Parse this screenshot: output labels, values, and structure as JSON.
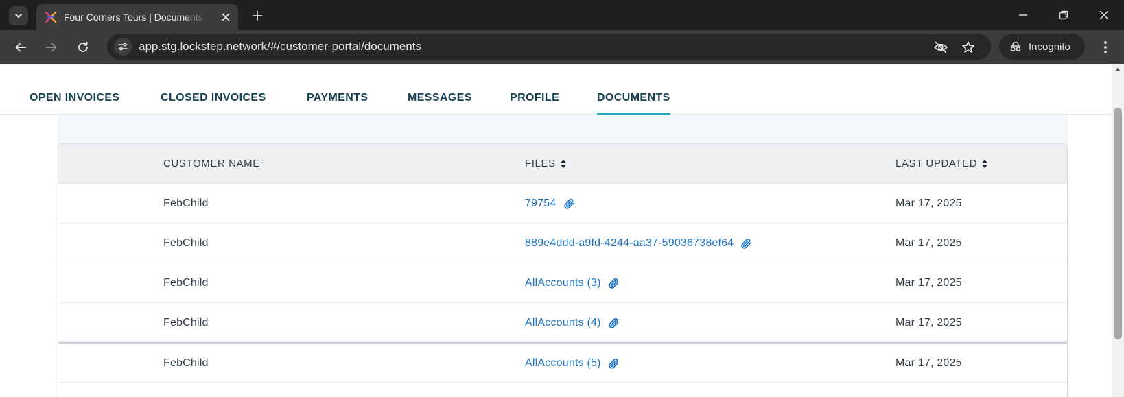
{
  "browser": {
    "tab_title": "Four Corners Tours | Documents",
    "url": "app.stg.lockstep.network/#/customer-portal/documents",
    "incognito_label": "Incognito",
    "colors": {
      "tabbar": "#1f1f1f",
      "toolbar": "#3c3c3c",
      "omnibox": "#282828"
    }
  },
  "nav": {
    "tabs": [
      {
        "label": "OPEN INVOICES"
      },
      {
        "label": "CLOSED INVOICES"
      },
      {
        "label": "PAYMENTS"
      },
      {
        "label": "MESSAGES"
      },
      {
        "label": "PROFILE"
      },
      {
        "label": "DOCUMENTS",
        "active": true
      }
    ],
    "accent_color": "#23a8bd"
  },
  "table": {
    "headers": {
      "customer_name": "CUSTOMER NAME",
      "files": "FILES",
      "last_updated": "LAST UPDATED"
    },
    "rows": [
      {
        "customer": "FebChild",
        "file": "79754",
        "updated": "Mar 17, 2025"
      },
      {
        "customer": "FebChild",
        "file": "889e4ddd-a9fd-4244-aa37-59036738ef64",
        "updated": "Mar 17, 2025"
      },
      {
        "customer": "FebChild",
        "file": "AllAccounts (3)",
        "updated": "Mar 17, 2025"
      },
      {
        "customer": "FebChild",
        "file": "AllAccounts (4)",
        "updated": "Mar 17, 2025"
      },
      {
        "customer": "FebChild",
        "file": "AllAccounts (5)",
        "updated": "Mar 17, 2025"
      }
    ],
    "link_color": "#1a73c4",
    "file_icon": "paperclip-icon"
  }
}
